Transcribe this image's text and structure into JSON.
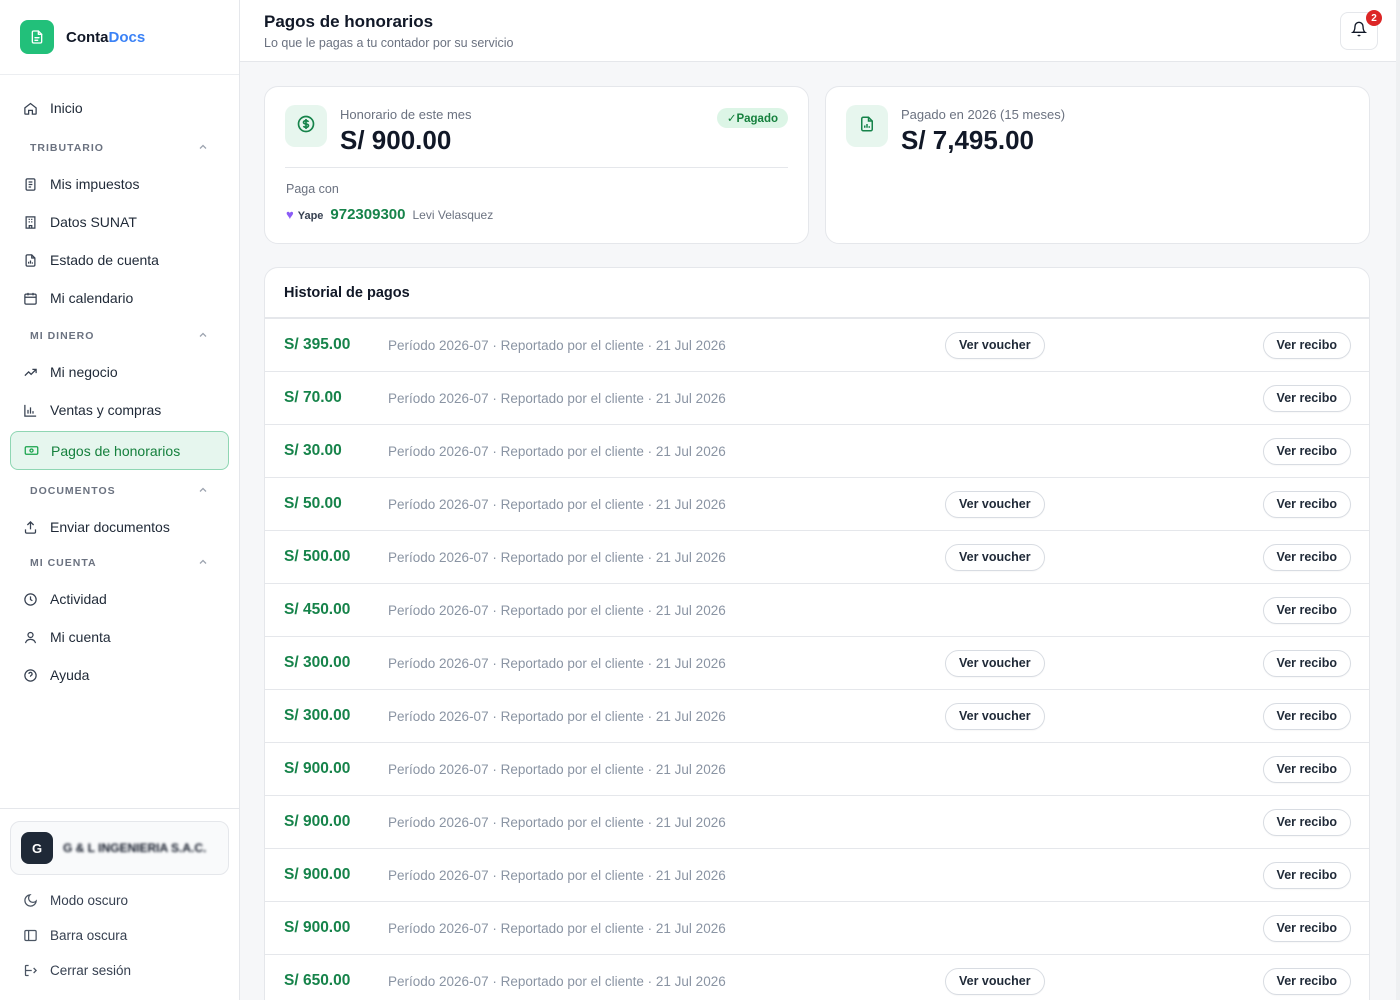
{
  "brand": {
    "name_part1": "Conta",
    "name_part2": "Docs"
  },
  "sidebar": {
    "home": "Inicio",
    "sections": [
      {
        "title": "TRIBUTARIO",
        "items": [
          "Mis impuestos",
          "Datos SUNAT",
          "Estado de cuenta",
          "Mi calendario"
        ]
      },
      {
        "title": "MI DINERO",
        "items": [
          "Mi negocio",
          "Ventas y compras",
          "Pagos de honorarios"
        ]
      },
      {
        "title": "DOCUMENTOS",
        "items": [
          "Enviar documentos"
        ]
      },
      {
        "title": "MI CUENTA",
        "items": [
          "Actividad",
          "Mi cuenta",
          "Ayuda"
        ]
      }
    ],
    "company": {
      "initial": "G",
      "name": "G & L INGENIERIA S.A.C."
    },
    "bottom": [
      "Modo oscuro",
      "Barra oscura",
      "Cerrar sesión"
    ]
  },
  "header": {
    "title": "Pagos de honorarios",
    "subtitle": "Lo que le pagas a tu contador por su servicio",
    "notifications_count": "2"
  },
  "fee_card": {
    "label": "Honorario de este mes",
    "amount": "S/ 900.00",
    "status": "✓Pagado",
    "pay_with_label": "Paga con",
    "method": "Yape",
    "phone": "972309300",
    "holder": "Levi Velasquez"
  },
  "total_card": {
    "label": "Pagado en 2026 (15 meses)",
    "amount": "S/ 7,495.00"
  },
  "history": {
    "title": "Historial de pagos",
    "voucher_label": "Ver voucher",
    "receipt_label": "Ver recibo",
    "rows": [
      {
        "amount": "S/ 395.00",
        "desc": "Período 2026-07 · Reportado por el cliente · 21 Jul 2026",
        "voucher": true
      },
      {
        "amount": "S/ 70.00",
        "desc": "Período 2026-07 · Reportado por el cliente · 21 Jul 2026",
        "voucher": false
      },
      {
        "amount": "S/ 30.00",
        "desc": "Período 2026-07 · Reportado por el cliente · 21 Jul 2026",
        "voucher": false
      },
      {
        "amount": "S/ 50.00",
        "desc": "Período 2026-07 · Reportado por el cliente · 21 Jul 2026",
        "voucher": true
      },
      {
        "amount": "S/ 500.00",
        "desc": "Período 2026-07 · Reportado por el cliente · 21 Jul 2026",
        "voucher": true
      },
      {
        "amount": "S/ 450.00",
        "desc": "Período 2026-07 · Reportado por el cliente · 21 Jul 2026",
        "voucher": false
      },
      {
        "amount": "S/ 300.00",
        "desc": "Período 2026-07 · Reportado por el cliente · 21 Jul 2026",
        "voucher": true
      },
      {
        "amount": "S/ 300.00",
        "desc": "Período 2026-07 · Reportado por el cliente · 21 Jul 2026",
        "voucher": true
      },
      {
        "amount": "S/ 900.00",
        "desc": "Período 2026-07 · Reportado por el cliente · 21 Jul 2026",
        "voucher": false
      },
      {
        "amount": "S/ 900.00",
        "desc": "Período 2026-07 · Reportado por el cliente · 21 Jul 2026",
        "voucher": false
      },
      {
        "amount": "S/ 900.00",
        "desc": "Período 2026-07 · Reportado por el cliente · 21 Jul 2026",
        "voucher": false
      },
      {
        "amount": "S/ 900.00",
        "desc": "Período 2026-07 · Reportado por el cliente · 21 Jul 2026",
        "voucher": false
      },
      {
        "amount": "S/ 650.00",
        "desc": "Período 2026-07 · Reportado por el cliente · 21 Jul 2026",
        "voucher": true
      }
    ]
  },
  "colors": {
    "accent": "#22c07a",
    "amount_green": "#16834a",
    "active_bg": "#e6f6ee",
    "badge_red": "#dc2626",
    "link_blue": "#3b82f6"
  }
}
